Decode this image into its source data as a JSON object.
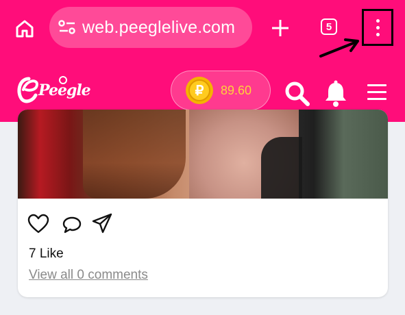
{
  "browser": {
    "url": "web.peeglelive.com",
    "tab_count": "5",
    "icons": [
      "home-icon",
      "site-info-icon",
      "plus-icon",
      "tab-switcher-icon",
      "more-vert-icon"
    ]
  },
  "site_header": {
    "logo_text": "Peegle",
    "coin_balance": "89.60",
    "coin_symbol": "₽",
    "icons": [
      "search-icon",
      "bell-icon",
      "hamburger-icon"
    ]
  },
  "post": {
    "likes_text": "7 Like",
    "comments_link": "View all 0 comments",
    "icons": [
      "heart-icon",
      "comment-icon",
      "send-icon"
    ]
  },
  "colors": {
    "brand": "#ff0d7a",
    "coin": "#ffd23a",
    "annotation": "#000000"
  }
}
